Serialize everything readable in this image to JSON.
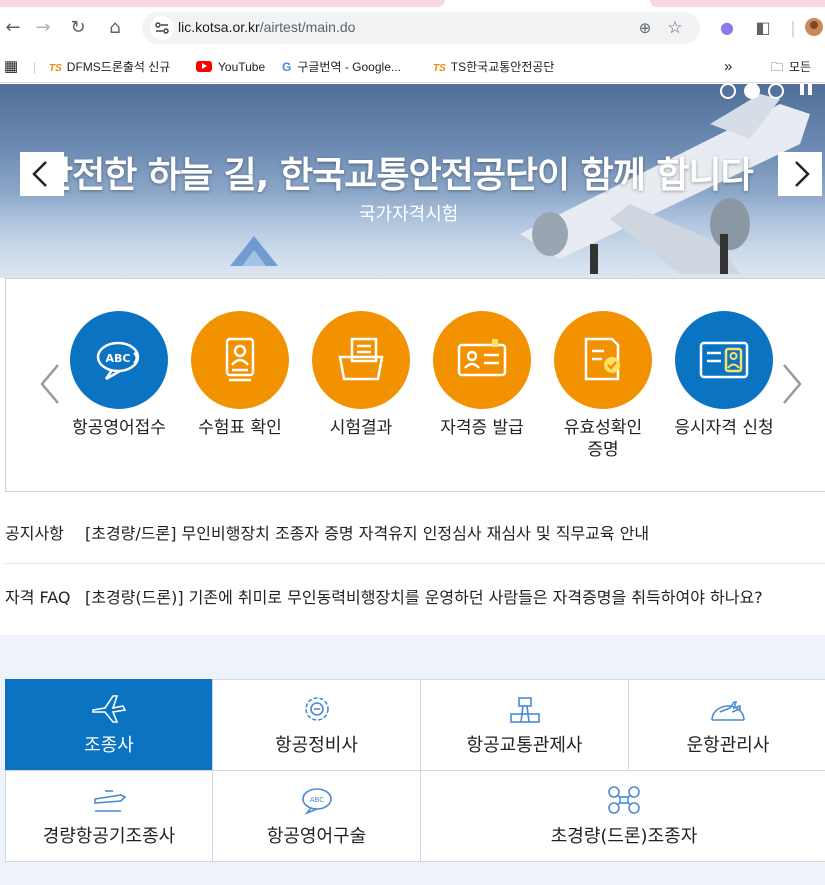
{
  "browser": {
    "url_host": "lic.kotsa.or.kr",
    "url_path": "/airtest/main.do",
    "bookmarks": [
      {
        "badge": "TS",
        "label": "DFMS드론출석 신규"
      },
      {
        "label": "YouTube"
      },
      {
        "label": "구글번역 - Google..."
      },
      {
        "badge": "TS",
        "label": "TS한국교통안전공단"
      }
    ],
    "more_label": "»",
    "all_bookmarks_label": "모든"
  },
  "hero": {
    "title": "안전한 하늘 길, 한국교통안전공단이 함께 합니다",
    "subtitle": "국가자격시험",
    "prev_label": "<",
    "next_label": ">"
  },
  "quick_menu": [
    {
      "label": "항공영어접수",
      "icon": "abc-chat-icon",
      "color": "#0a73c2"
    },
    {
      "label": "수험표 확인",
      "icon": "id-badge-icon",
      "color": "#f39200"
    },
    {
      "label": "시험결과",
      "icon": "folder-docs-icon",
      "color": "#f39200"
    },
    {
      "label": "자격증 발급",
      "icon": "id-card-icon",
      "color": "#f39200"
    },
    {
      "label": "유효성확인 증명",
      "icon": "doc-check-icon",
      "color": "#f39200"
    },
    {
      "label": "응시자격 신청",
      "icon": "id-card-check-icon",
      "color": "#0a73c2"
    }
  ],
  "notices": [
    {
      "category": "공지사항",
      "text": "[초경량/드론] 무인비행장치 조종자 증명 자격유지 인정심사 재심사 및 직무교육 안내"
    },
    {
      "category": "자격 FAQ",
      "text": "[초경량(드론)] 기존에 취미로 무인동력비행장치를 운영하던 사람들은 자격증명을 취득하여야 하나요?"
    }
  ],
  "categories": [
    {
      "label": "조종사",
      "icon": "airplane-icon",
      "active": true
    },
    {
      "label": "항공정비사",
      "icon": "gear-icon",
      "active": false
    },
    {
      "label": "항공교통관제사",
      "icon": "control-tower-icon",
      "active": false
    },
    {
      "label": "운항관리사",
      "icon": "flight-dispatch-icon",
      "active": false
    },
    {
      "label": "경량항공기조종사",
      "icon": "light-aircraft-icon",
      "active": false
    },
    {
      "label": "항공영어구술",
      "icon": "abc-speech-icon",
      "active": false
    },
    {
      "label": "초경량(드론)조종자",
      "icon": "drone-icon",
      "active": false
    }
  ],
  "colors": {
    "brand_blue": "#0a73c2",
    "brand_orange": "#f39200"
  }
}
